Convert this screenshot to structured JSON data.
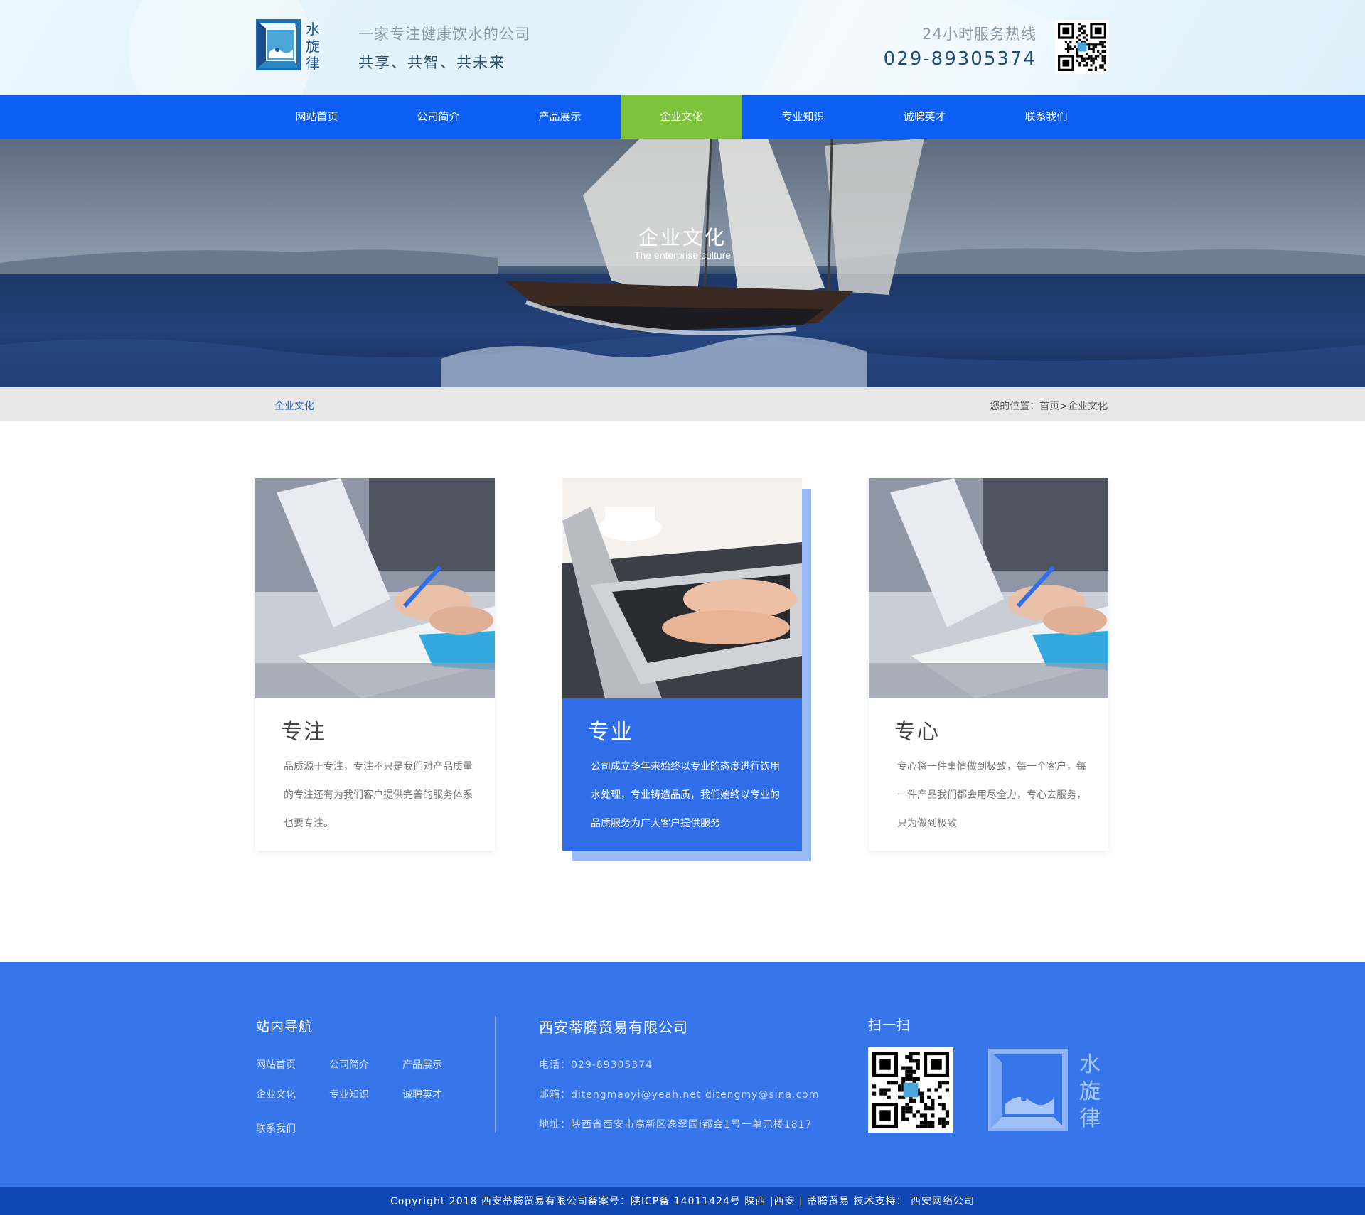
{
  "header": {
    "logo_text": [
      "水",
      "旋",
      "律"
    ],
    "slogan_line1": "一家专注健康饮水的公司",
    "slogan_line2": "共享、共智、共未来",
    "hotline_label": "24小时服务热线",
    "hotline_number": "029-89305374"
  },
  "nav": {
    "items": [
      {
        "label": "网站首页"
      },
      {
        "label": "公司简介"
      },
      {
        "label": "产品展示"
      },
      {
        "label": "企业文化",
        "active": true
      },
      {
        "label": "专业知识"
      },
      {
        "label": "诚聘英才"
      },
      {
        "label": "联系我们"
      }
    ]
  },
  "banner": {
    "title": "企业文化",
    "subtitle": "The enterprise culture"
  },
  "breadcrumb": {
    "section": "企业文化",
    "prefix": "您的位置：",
    "home": "首页",
    "separator": ">",
    "current": "企业文化"
  },
  "cards": [
    {
      "title": "专注",
      "desc": "品质源于专注，专注不只是我们对产品质量的专注还有为我们客户提供完善的服务体系也要专注。"
    },
    {
      "title": "专业",
      "desc": "公司成立多年来始终以专业的态度进行饮用水处理，专业铸造品质，我们始终以专业的品质服务为广大客户提供服务"
    },
    {
      "title": "专心",
      "desc": "专心将一件事情做到极致，每一个客户，每一件产品我们都会用尽全力，专心去服务，只为做到极致"
    }
  ],
  "footer": {
    "nav_title": "站内导航",
    "nav_links": [
      "网站首页",
      "公司简介",
      "产品展示",
      "企业文化",
      "专业知识",
      "诚聘英才",
      "联系我们"
    ],
    "company_name": "西安蒂腾贸易有限公司",
    "phone": "电话：029-89305374",
    "email": "邮箱：ditengmaoyi@yeah.net  ditengmy@sina.com",
    "address": "地址：陕西省西安市高新区逸翠园i都会1号一单元楼1817",
    "scan_title": "扫一扫",
    "logo_text": [
      "水",
      "旋",
      "律"
    ],
    "copyright": "Copyright  2018 西安蒂腾贸易有限公司备案号：陕ICP备 14011424号    陕西 |西安 |  蒂腾贸易    技术支持： 西安网络公司"
  },
  "colors": {
    "nav_bg": "#0c5ff2",
    "nav_active": "#7dc33b",
    "card_accent": "#2f6ee8",
    "footer_bg": "#3675ea",
    "copyright_bg": "#0f48b5"
  },
  "icons": [
    "logo-mark",
    "qr-code-icon",
    "footer-logo-mark"
  ]
}
